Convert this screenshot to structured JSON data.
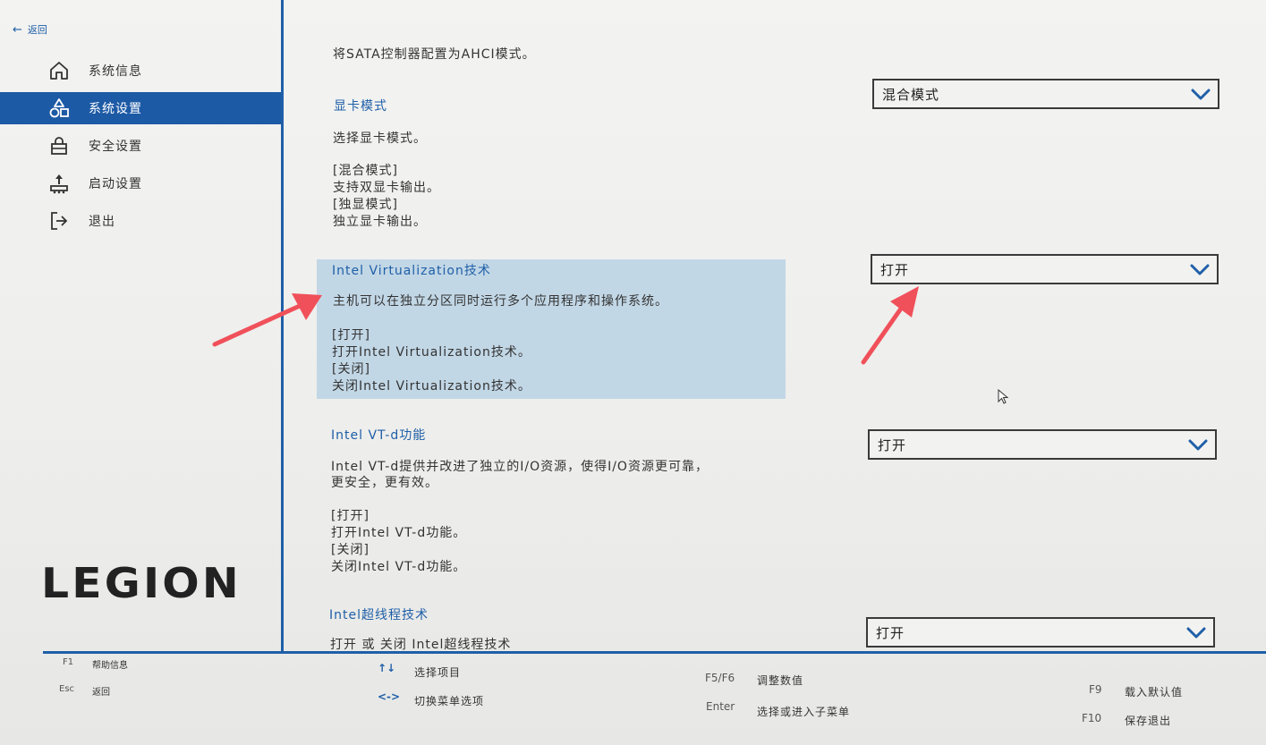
{
  "back": {
    "label": "返回"
  },
  "nav": {
    "items": [
      {
        "label": "系统信息",
        "icon": "home-icon"
      },
      {
        "label": "系统设置",
        "icon": "settings-shapes-icon"
      },
      {
        "label": "安全设置",
        "icon": "lock-icon"
      },
      {
        "label": "启动设置",
        "icon": "boot-icon"
      },
      {
        "label": "退出",
        "icon": "exit-icon"
      }
    ],
    "active_index": 1,
    "logo": "LEGION"
  },
  "content": {
    "sata_desc": "将SATA控制器配置为AHCI模式。",
    "gpu": {
      "title": "显卡模式",
      "desc": "选择显卡模式。",
      "opt1": "[混合模式]",
      "opt1_desc": "支持双显卡输出。",
      "opt2": "[独显模式]",
      "opt2_desc": "独立显卡输出。",
      "value": "混合模式"
    },
    "virt": {
      "title": "Intel Virtualization技术",
      "desc": "主机可以在独立分区同时运行多个应用程序和操作系统。",
      "opt1": "[打开]",
      "opt1_desc": "打开Intel Virtualization技术。",
      "opt2": "[关闭]",
      "opt2_desc": "关闭Intel Virtualization技术。",
      "value": "打开"
    },
    "vtd": {
      "title": "Intel VT-d功能",
      "desc1": "Intel VT-d提供并改进了独立的I/O资源，使得I/O资源更可靠，",
      "desc2": "更安全，更有效。",
      "opt1": "[打开]",
      "opt1_desc": "打开Intel VT-d功能。",
      "opt2": "[关闭]",
      "opt2_desc": "关闭Intel VT-d功能。",
      "value": "打开"
    },
    "ht": {
      "title": "Intel超线程技术",
      "desc": "打开 或 关闭 Intel超线程技术",
      "value": "打开"
    }
  },
  "footer": {
    "f1_key": "F1",
    "f1_desc": "帮助信息",
    "esc_key": "Esc",
    "esc_desc": "返回",
    "updown_desc": "选择项目",
    "leftright_desc": "切换菜单选项",
    "f5f6_key": "F5/F6",
    "f5f6_desc": "调整数值",
    "enter_key": "Enter",
    "enter_desc": "选择或进入子菜单",
    "f9_key": "F9",
    "f9_desc": "载入默认值",
    "f10_key": "F10",
    "f10_desc": "保存退出"
  },
  "colors": {
    "accent": "#1d5aa5",
    "highlight": "#c2d7e6",
    "annotation": "#f0505a"
  }
}
